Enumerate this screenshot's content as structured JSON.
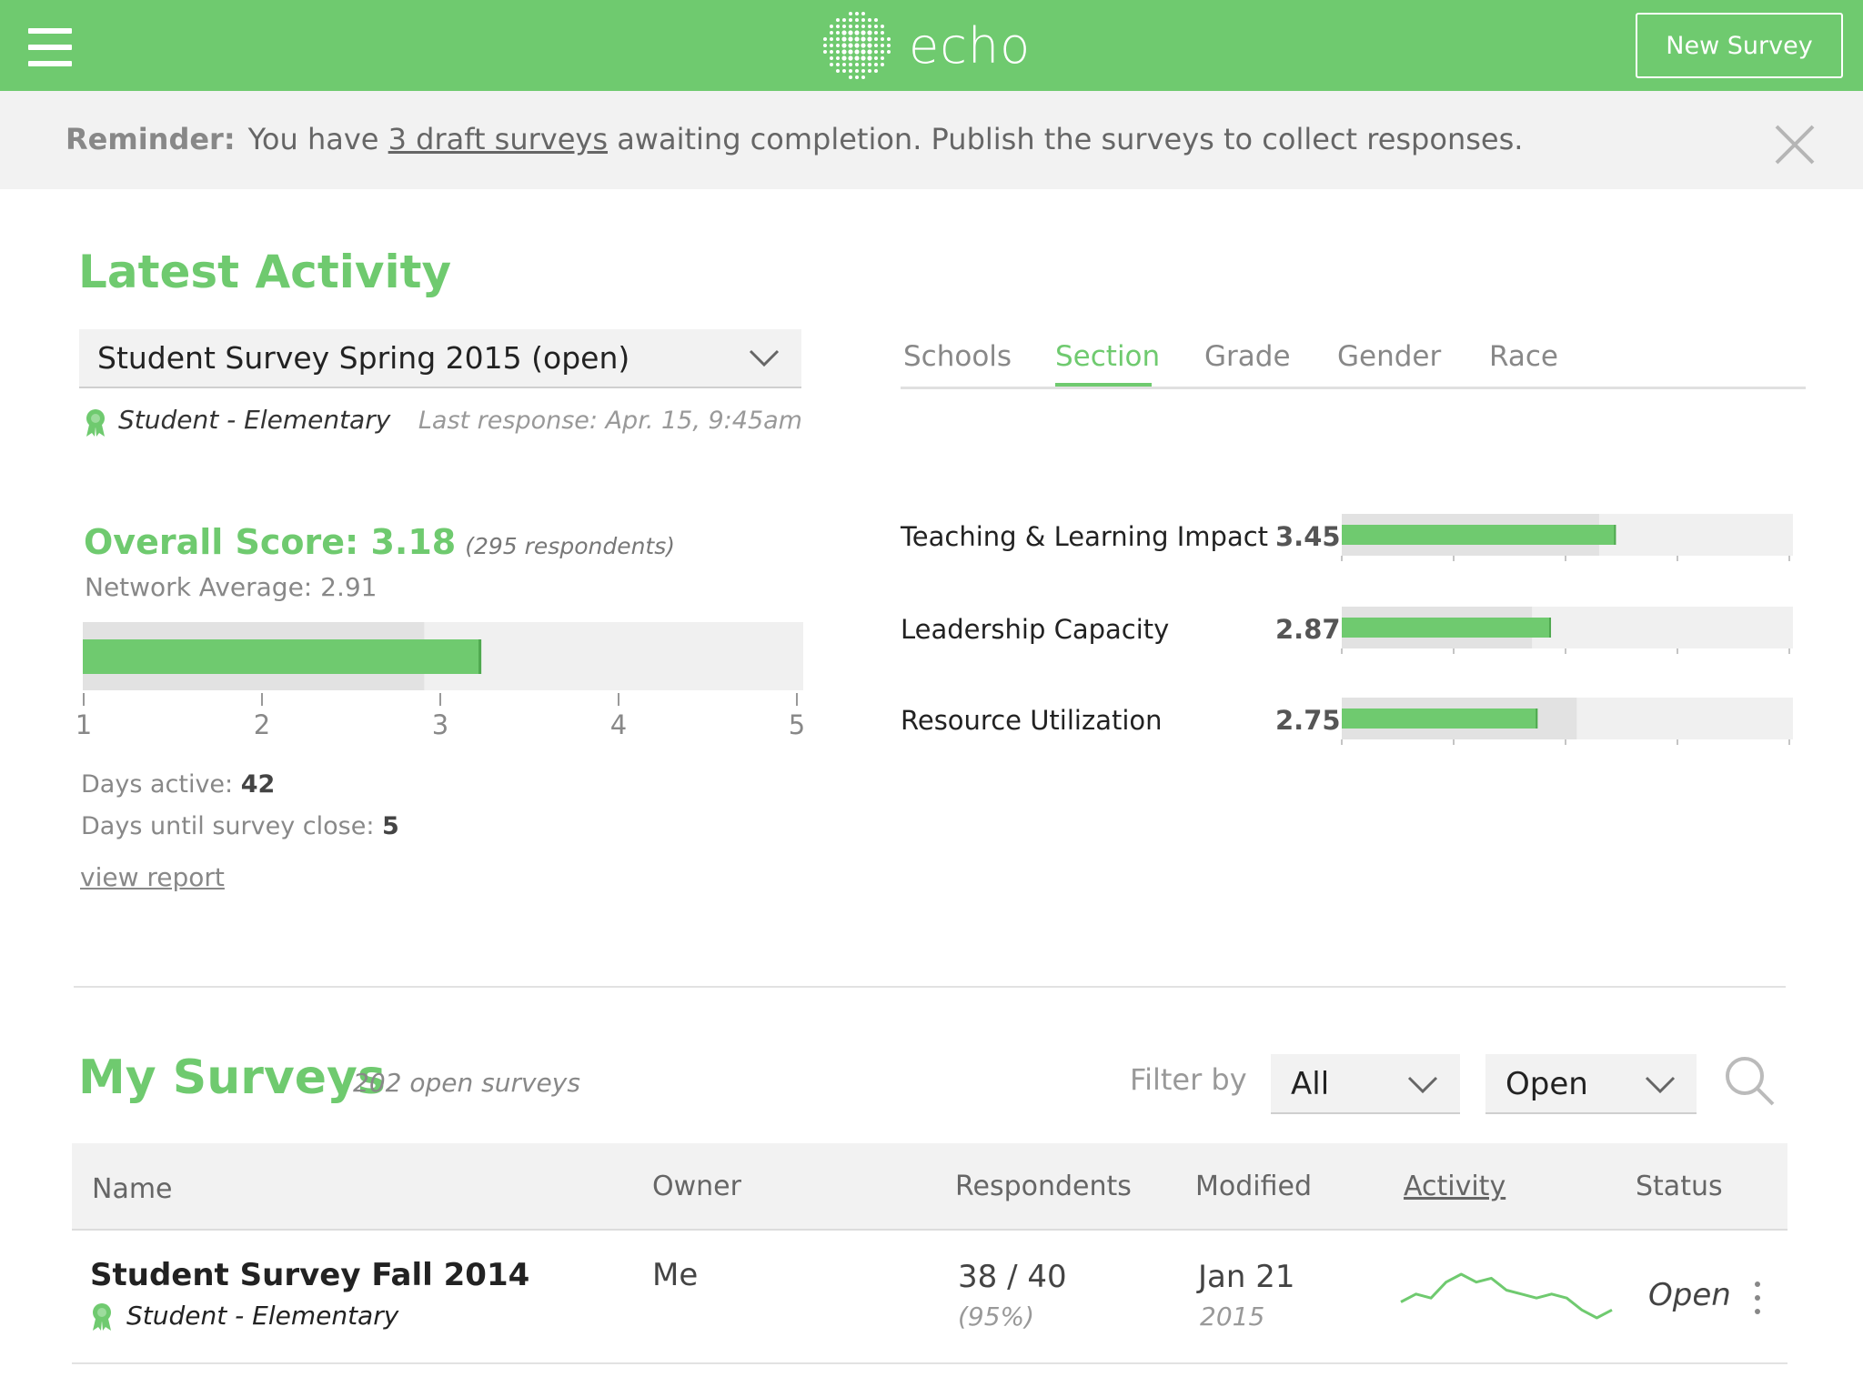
{
  "app": {
    "name": "echo",
    "new_survey_label": "New Survey"
  },
  "colors": {
    "accent": "#6fca6f",
    "bar_track": "#f0f0f0",
    "bar_average": "#e2e2e2"
  },
  "reminder": {
    "label": "Reminder:",
    "text_before": "You have",
    "link": "3 draft surveys",
    "text_after": "awaiting completion. Publish the surveys to collect responses."
  },
  "latest": {
    "title": "Latest Activity",
    "selected_survey": "Student Survey Spring 2015 (open)",
    "survey_type": "Student - Elementary",
    "last_response": "Last response:  Apr. 15, 9:45am",
    "overall_label": "Overall Score: 3.18",
    "respondents": "(295 respondents)",
    "network_label": "Network Average: 2.91",
    "score_scale": {
      "min": 1,
      "max": 5,
      "ticks": [
        "1",
        "2",
        "3",
        "4",
        "5"
      ],
      "score": 3.23,
      "network_average": 2.91
    },
    "days_active_label": "Days active:",
    "days_active": "42",
    "days_close_label": "Days until survey close:",
    "days_close": "5",
    "view_report": "view report"
  },
  "tabs": [
    {
      "label": "Schools",
      "active": false
    },
    {
      "label": "Section",
      "active": true
    },
    {
      "label": "Grade",
      "active": false
    },
    {
      "label": "Gender",
      "active": false
    },
    {
      "label": "Race",
      "active": false
    }
  ],
  "metrics": [
    {
      "label": "Teaching & Learning Impact",
      "value": "3.45",
      "score": 3.45,
      "network_average": 3.3
    },
    {
      "label": "Leadership Capacity",
      "value": "2.87",
      "score": 2.87,
      "network_average": 2.7
    },
    {
      "label": "Resource Utilization",
      "value": "2.75",
      "score": 2.75,
      "network_average": 3.1
    }
  ],
  "my_surveys": {
    "title": "My Surveys",
    "count": "202 open surveys",
    "filter_label": "Filter by",
    "filter_type": "All",
    "filter_status": "Open",
    "columns": [
      "Name",
      "Owner",
      "Respondents",
      "Modified",
      "Activity",
      "Status"
    ],
    "rows": [
      {
        "name": "Student Survey Fall 2014",
        "type": "Student - Elementary",
        "owner": "Me",
        "respondents": "38 / 40",
        "respondents_pct": "(95%)",
        "modified": "Jan 21",
        "modified_year": "2015",
        "activity": [
          4,
          6,
          5,
          9,
          11,
          9,
          10,
          7,
          6,
          5,
          6,
          5,
          2,
          0,
          2
        ],
        "status": "Open"
      }
    ]
  }
}
